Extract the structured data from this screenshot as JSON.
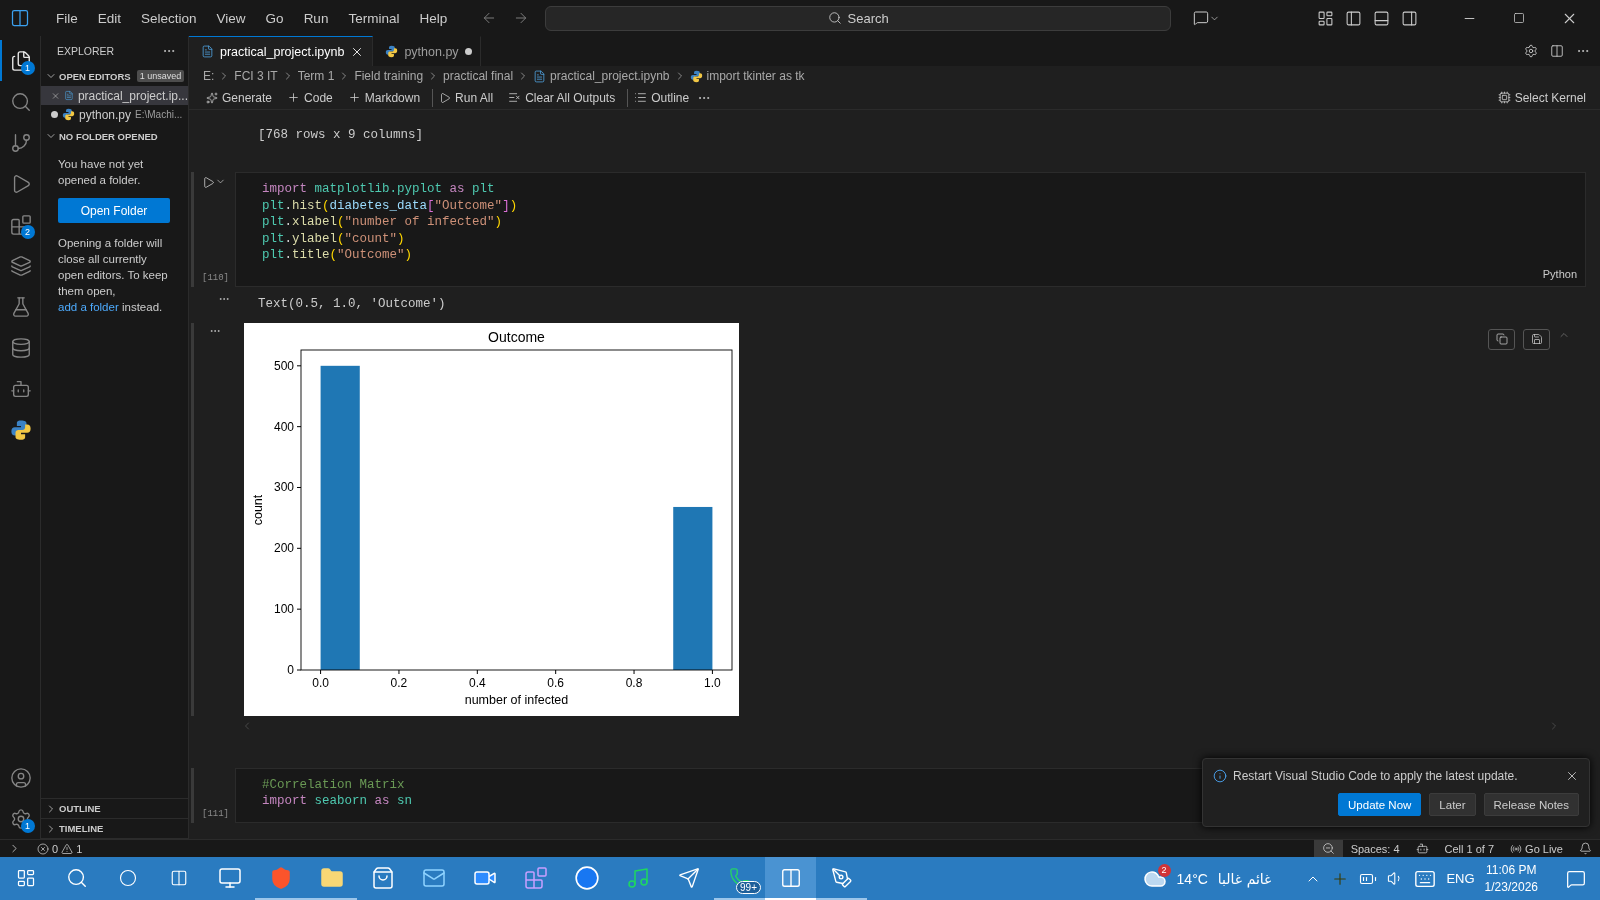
{
  "title_bar": {
    "menu": [
      "File",
      "Edit",
      "Selection",
      "View",
      "Go",
      "Run",
      "Terminal",
      "Help"
    ],
    "search": {
      "placeholder": "Search"
    }
  },
  "activity_bar": {
    "items": [
      {
        "kind": "explorer",
        "selected": true,
        "badge": "1"
      },
      {
        "kind": "search",
        "selected": false
      },
      {
        "kind": "source-control",
        "selected": false
      },
      {
        "kind": "run",
        "selected": false
      },
      {
        "kind": "extensions",
        "selected": false,
        "badge": "2"
      },
      {
        "kind": "layers",
        "selected": false
      },
      {
        "kind": "testing",
        "selected": false
      },
      {
        "kind": "database",
        "selected": false
      },
      {
        "kind": "robot",
        "selected": false
      },
      {
        "kind": "python",
        "selected": false
      }
    ],
    "bottom": [
      {
        "kind": "account"
      },
      {
        "kind": "settings",
        "badge": "1"
      }
    ]
  },
  "sidebar": {
    "title": "EXPLORER",
    "open_editors": {
      "title": "OPEN EDITORS",
      "expanded": true,
      "badge": "1 unsaved",
      "items": [
        {
          "kind": "notebook",
          "name": "practical_project.ip...",
          "selected": true,
          "dirty": false
        },
        {
          "kind": "python",
          "name": "python.py",
          "description": "E:\\Machi...",
          "selected": false,
          "dirty": true
        }
      ]
    },
    "no_folder": {
      "title": "NO FOLDER OPENED",
      "expanded": true,
      "message": "You have not yet opened a folder.",
      "button": "Open Folder",
      "note_before": "Opening a folder will close all currently open editors. To keep them open,",
      "link": "add a folder",
      "note_after": "instead."
    },
    "bottom_sections": [
      {
        "title": "OUTLINE",
        "expanded": false
      },
      {
        "title": "TIMELINE",
        "expanded": false
      }
    ]
  },
  "tabs": [
    {
      "kind": "notebook",
      "label": "practical_project.ipynb",
      "selected": true,
      "dirty": false
    },
    {
      "kind": "python",
      "label": "python.py",
      "selected": false,
      "dirty": true
    }
  ],
  "breadcrumbs": [
    {
      "kind": "path",
      "label": "E:"
    },
    {
      "kind": "path",
      "label": "FCI 3 IT"
    },
    {
      "kind": "path",
      "label": "Term 1"
    },
    {
      "kind": "path",
      "label": "Field training"
    },
    {
      "kind": "path",
      "label": "practical final"
    },
    {
      "kind": "notebook",
      "label": "practical_project.ipynb"
    },
    {
      "kind": "python",
      "label": "import tkinter as tk"
    }
  ],
  "toolbar": {
    "items": [
      {
        "kind": "generate",
        "label": "Generate",
        "separated": false
      },
      {
        "kind": "add",
        "label": "Code",
        "separated": false
      },
      {
        "kind": "add",
        "label": "Markdown",
        "separated": false
      },
      {
        "kind": "run-all",
        "label": "Run All",
        "separated": true
      },
      {
        "kind": "clear",
        "label": "Clear All Outputs",
        "separated": false
      },
      {
        "kind": "outline",
        "label": "Outline",
        "separated": true
      }
    ],
    "kernel": "Select Kernel"
  },
  "notebook": {
    "items": [
      {
        "kind": "output",
        "text": "[768 rows x 9 columns]"
      },
      {
        "kind": "code",
        "count": "[110]",
        "language": "Python",
        "lines": [
          [
            {
              "kind": "kw",
              "t": "import "
            },
            {
              "kind": "mod",
              "t": "matplotlib.pyplot "
            },
            {
              "kind": "kw",
              "t": "as "
            },
            {
              "kind": "mod",
              "t": "plt"
            }
          ],
          [
            {
              "kind": "mod",
              "t": "plt"
            },
            {
              "kind": "p",
              "t": "."
            },
            {
              "kind": "fn",
              "t": "hist"
            },
            {
              "kind": "b1",
              "t": "("
            },
            {
              "kind": "var",
              "t": "diabetes_data"
            },
            {
              "kind": "b2",
              "t": "["
            },
            {
              "kind": "str",
              "t": "\"Outcome\""
            },
            {
              "kind": "b2",
              "t": "]"
            },
            {
              "kind": "b1",
              "t": ")"
            }
          ],
          [
            {
              "kind": "mod",
              "t": "plt"
            },
            {
              "kind": "p",
              "t": "."
            },
            {
              "kind": "fn",
              "t": "xlabel"
            },
            {
              "kind": "b1",
              "t": "("
            },
            {
              "kind": "str",
              "t": "\"number of infected\""
            },
            {
              "kind": "b1",
              "t": ")"
            }
          ],
          [
            {
              "kind": "mod",
              "t": "plt"
            },
            {
              "kind": "p",
              "t": "."
            },
            {
              "kind": "fn",
              "t": "ylabel"
            },
            {
              "kind": "b1",
              "t": "("
            },
            {
              "kind": "str",
              "t": "\"count\""
            },
            {
              "kind": "b1",
              "t": ")"
            }
          ],
          [
            {
              "kind": "mod",
              "t": "plt"
            },
            {
              "kind": "p",
              "t": "."
            },
            {
              "kind": "fn",
              "t": "title"
            },
            {
              "kind": "b1",
              "t": "("
            },
            {
              "kind": "str",
              "t": "\"Outcome\""
            },
            {
              "kind": "b1",
              "t": ")"
            }
          ]
        ]
      },
      {
        "kind": "output",
        "text": "Text(0.5, 1.0, 'Outcome')"
      },
      {
        "kind": "chart",
        "chart_data": {
          "type": "bar",
          "title": "Outcome",
          "xlabel": "number of infected",
          "ylabel": "count",
          "x": [
            0.05,
            0.95
          ],
          "series": [
            {
              "color": "#1f77b4",
              "values": [
                500,
                268
              ]
            }
          ],
          "xlim": [
            -0.05,
            1.05
          ],
          "ylim": [
            0,
            526
          ],
          "xticks": [
            {
              "value": 0,
              "label": "0.0"
            },
            {
              "value": 0.2,
              "label": "0.2"
            },
            {
              "value": 0.4,
              "label": "0.4"
            },
            {
              "value": 0.6,
              "label": "0.6"
            },
            {
              "value": 0.8,
              "label": "0.8"
            },
            {
              "value": 1,
              "label": "1.0"
            }
          ],
          "yticks": [
            0,
            100,
            200,
            300,
            400,
            500
          ]
        }
      },
      {
        "kind": "code",
        "count": "[111]",
        "lines": [
          [
            {
              "kind": "cm",
              "t": "#Correlation Matrix"
            }
          ],
          [
            {
              "kind": "kw",
              "t": "import "
            },
            {
              "kind": "mod",
              "t": "seaborn "
            },
            {
              "kind": "kw",
              "t": "as "
            },
            {
              "kind": "mod",
              "t": "sn"
            }
          ]
        ]
      }
    ]
  },
  "notification": {
    "message": "Restart Visual Studio Code to apply the latest update.",
    "buttons": [
      {
        "label": "Update Now",
        "primary": true
      },
      {
        "label": "Later",
        "primary": false
      },
      {
        "label": "Release Notes",
        "primary": false
      }
    ]
  },
  "status_bar": {
    "errors": "0",
    "warnings": "1",
    "right": [
      {
        "kind": "zoom"
      },
      {
        "kind": "text",
        "label": "Spaces: 4"
      },
      {
        "kind": "copilot"
      },
      {
        "kind": "text",
        "label": "Cell 1 of 7"
      },
      {
        "kind": "live",
        "label": "Go Live"
      },
      {
        "kind": "bell"
      }
    ]
  },
  "taskbar": {
    "apps": [
      {
        "kind": "computer",
        "running": false,
        "selected": false
      },
      {
        "kind": "brave",
        "running": true,
        "selected": false
      },
      {
        "kind": "folder",
        "running": true,
        "selected": false
      },
      {
        "kind": "store",
        "running": false,
        "selected": false
      },
      {
        "kind": "mail",
        "running": false,
        "selected": false
      },
      {
        "kind": "zoom",
        "running": false,
        "selected": false
      },
      {
        "kind": "studio",
        "running": false,
        "selected": false
      },
      {
        "kind": "facebook",
        "running": false,
        "selected": false
      },
      {
        "kind": "spotify",
        "running": false,
        "selected": false
      },
      {
        "kind": "telegram",
        "running": false,
        "selected": false
      },
      {
        "kind": "whatsapp",
        "running": true,
        "selected": false,
        "badge": "99+"
      },
      {
        "kind": "vscode",
        "running": true,
        "selected": true
      },
      {
        "kind": "pen",
        "running": true,
        "selected": false
      }
    ],
    "weather": {
      "badge": "2",
      "temperature": "14°C",
      "condition": "غائم غالبا"
    },
    "language": "ENG",
    "time": "11:06 PM",
    "date": "1/23/2026"
  }
}
